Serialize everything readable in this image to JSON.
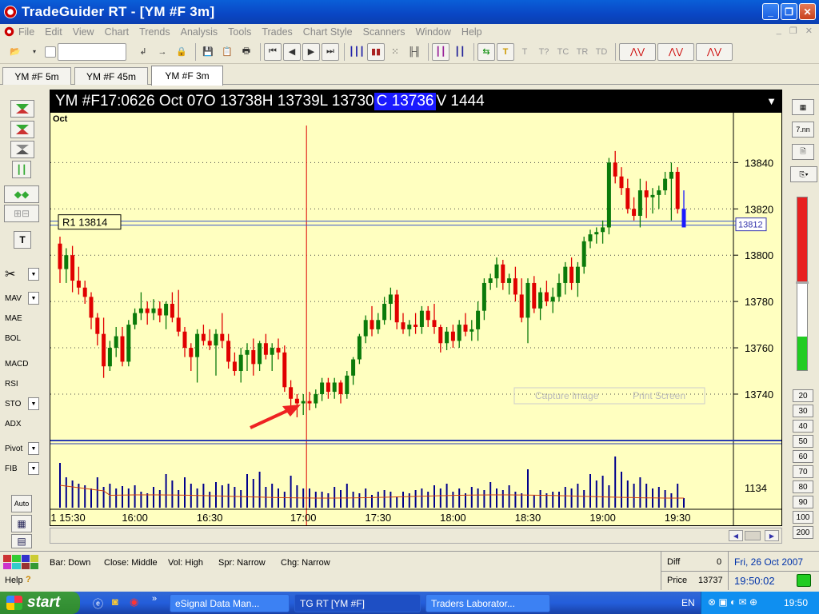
{
  "app": {
    "title": "TradeGuider RT   - [YM #F 3m]"
  },
  "menu": [
    "File",
    "Edit",
    "View",
    "Chart",
    "Trends",
    "Analysis",
    "Tools",
    "Trades",
    "Chart Style",
    "Scanners",
    "Window",
    "Help"
  ],
  "tabs": [
    {
      "label": "YM #F 5m"
    },
    {
      "label": "YM #F 45m"
    },
    {
      "label": "YM #F 3m"
    }
  ],
  "left_panel": {
    "labels": [
      "MAV",
      "MAE",
      "BOL",
      "MACD",
      "RSI",
      "STO",
      "ADX",
      "Pivot",
      "FIB"
    ],
    "auto": "Auto",
    "text_tool": "T"
  },
  "right_panel": {
    "zoom_label": "7.nn",
    "periods": [
      "20",
      "30",
      "40",
      "50",
      "60",
      "70",
      "80",
      "90",
      "100",
      "200"
    ]
  },
  "chart": {
    "info": {
      "symbol": "YM #F",
      "time": "17:06",
      "date": "26 Oct 07",
      "open": "O 13738",
      "high": "H 13739",
      "low": "L 13730",
      "close": "C 13736",
      "volume": "V 1444"
    },
    "month": "Oct",
    "pivot_label": "R1 13814",
    "price_tag": "13812",
    "volume_label": "1134",
    "overlay": {
      "capture": "Capture Image",
      "print": "Print Screen"
    },
    "colors": {
      "up": "#0a7a0a",
      "down": "#e00000",
      "background": "#ffffc0",
      "volume": "#00008b",
      "pivot": "#3a55c8"
    }
  },
  "chart_data": {
    "type": "candlestick",
    "x_ticks": [
      "15:30",
      "16:00",
      "16:30",
      "17:00",
      "17:30",
      "18:00",
      "18:30",
      "19:00",
      "19:30"
    ],
    "y_ticks": [
      13740,
      13760,
      13780,
      13800,
      13820,
      13840
    ],
    "ylim": [
      13721,
      13856
    ],
    "pivot_R1": 13814,
    "marked_bar_time": "17:00",
    "candles": [
      [
        13805,
        13808,
        13788,
        13794
      ],
      [
        13794,
        13803,
        13788,
        13800
      ],
      [
        13800,
        13804,
        13784,
        13789
      ],
      [
        13789,
        13795,
        13783,
        13786
      ],
      [
        13786,
        13789,
        13779,
        13782
      ],
      [
        13782,
        13784,
        13768,
        13773
      ],
      [
        13773,
        13775,
        13761,
        13766
      ],
      [
        13766,
        13773,
        13747,
        13752
      ],
      [
        13752,
        13763,
        13750,
        13760
      ],
      [
        13760,
        13769,
        13756,
        13765
      ],
      [
        13765,
        13769,
        13752,
        13754
      ],
      [
        13754,
        13772,
        13752,
        13770
      ],
      [
        13770,
        13777,
        13768,
        13775
      ],
      [
        13775,
        13784,
        13772,
        13777
      ],
      [
        13777,
        13780,
        13770,
        13775
      ],
      [
        13775,
        13781,
        13772,
        13777
      ],
      [
        13777,
        13780,
        13771,
        13774
      ],
      [
        13774,
        13780,
        13768,
        13779
      ],
      [
        13779,
        13784,
        13771,
        13773
      ],
      [
        13773,
        13785,
        13765,
        13767
      ],
      [
        13767,
        13769,
        13756,
        13760
      ],
      [
        13760,
        13762,
        13750,
        13756
      ],
      [
        13756,
        13768,
        13745,
        13766
      ],
      [
        13766,
        13770,
        13761,
        13763
      ],
      [
        13763,
        13768,
        13759,
        13761
      ],
      [
        13761,
        13768,
        13748,
        13766
      ],
      [
        13766,
        13775,
        13760,
        13763
      ],
      [
        13763,
        13766,
        13751,
        13754
      ],
      [
        13754,
        13758,
        13748,
        13750
      ],
      [
        13750,
        13760,
        13745,
        13757
      ],
      [
        13757,
        13762,
        13750,
        13759
      ],
      [
        13759,
        13764,
        13748,
        13753
      ],
      [
        13753,
        13763,
        13750,
        13762
      ],
      [
        13762,
        13766,
        13755,
        13757
      ],
      [
        13757,
        13762,
        13750,
        13760
      ],
      [
        13760,
        13764,
        13755,
        13758
      ],
      [
        13758,
        13761,
        13741,
        13743
      ],
      [
        13743,
        13746,
        13735,
        13738
      ],
      [
        13738,
        13740,
        13730,
        13736
      ],
      [
        13736,
        13740,
        13731,
        13737
      ],
      [
        13737,
        13741,
        13733,
        13736
      ],
      [
        13736,
        13742,
        13734,
        13740
      ],
      [
        13740,
        13747,
        13737,
        13745
      ],
      [
        13745,
        13747,
        13738,
        13741
      ],
      [
        13741,
        13747,
        13738,
        13745
      ],
      [
        13745,
        13746,
        13736,
        13740
      ],
      [
        13740,
        13750,
        13738,
        13748
      ],
      [
        13748,
        13756,
        13744,
        13755
      ],
      [
        13755,
        13766,
        13753,
        13765
      ],
      [
        13765,
        13774,
        13762,
        13772
      ],
      [
        13772,
        13778,
        13765,
        13768
      ],
      [
        13768,
        13775,
        13766,
        13772
      ],
      [
        13772,
        13782,
        13770,
        13779
      ],
      [
        13779,
        13786,
        13772,
        13783
      ],
      [
        13783,
        13785,
        13768,
        13771
      ],
      [
        13771,
        13775,
        13766,
        13768
      ],
      [
        13768,
        13772,
        13765,
        13770
      ],
      [
        13770,
        13775,
        13766,
        13769
      ],
      [
        13769,
        13778,
        13766,
        13776
      ],
      [
        13776,
        13778,
        13769,
        13772
      ],
      [
        13772,
        13779,
        13766,
        13769
      ],
      [
        13769,
        13770,
        13758,
        13762
      ],
      [
        13762,
        13769,
        13759,
        13767
      ],
      [
        13767,
        13770,
        13760,
        13763
      ],
      [
        13763,
        13772,
        13760,
        13770
      ],
      [
        13770,
        13775,
        13765,
        13767
      ],
      [
        13767,
        13772,
        13763,
        13768
      ],
      [
        13768,
        13780,
        13763,
        13776
      ],
      [
        13776,
        13790,
        13772,
        13788
      ],
      [
        13788,
        13792,
        13785,
        13790
      ],
      [
        13790,
        13799,
        13786,
        13796
      ],
      [
        13796,
        13798,
        13785,
        13788
      ],
      [
        13788,
        13792,
        13783,
        13790
      ],
      [
        13790,
        13795,
        13780,
        13783
      ],
      [
        13783,
        13790,
        13771,
        13773
      ],
      [
        13773,
        13790,
        13762,
        13788
      ],
      [
        13788,
        13791,
        13775,
        13777
      ],
      [
        13777,
        13786,
        13772,
        13784
      ],
      [
        13784,
        13789,
        13778,
        13780
      ],
      [
        13780,
        13786,
        13775,
        13782
      ],
      [
        13782,
        13792,
        13780,
        13788
      ],
      [
        13788,
        13797,
        13783,
        13795
      ],
      [
        13795,
        13799,
        13785,
        13788
      ],
      [
        13788,
        13797,
        13782,
        13795
      ],
      [
        13795,
        13808,
        13792,
        13806
      ],
      [
        13806,
        13811,
        13803,
        13809
      ],
      [
        13809,
        13812,
        13805,
        13810
      ],
      [
        13810,
        13815,
        13805,
        13812
      ],
      [
        13812,
        13842,
        13809,
        13840
      ],
      [
        13840,
        13845,
        13831,
        13834
      ],
      [
        13834,
        13838,
        13826,
        13829
      ],
      [
        13829,
        13833,
        13818,
        13820
      ],
      [
        13820,
        13825,
        13815,
        13817
      ],
      [
        13817,
        13833,
        13812,
        13828
      ],
      [
        13828,
        13832,
        13816,
        13825
      ],
      [
        13825,
        13829,
        13818,
        13826
      ],
      [
        13826,
        13830,
        13820,
        13828
      ],
      [
        13828,
        13836,
        13826,
        13833
      ],
      [
        13833,
        13840,
        13815,
        13836
      ],
      [
        13836,
        13838,
        13818,
        13820
      ],
      [
        13820,
        13828,
        13815,
        13812
      ]
    ],
    "volume": [
      56,
      38,
      34,
      30,
      28,
      24,
      38,
      26,
      30,
      24,
      27,
      24,
      28,
      20,
      18,
      26,
      22,
      42,
      34,
      22,
      38,
      30,
      24,
      30,
      20,
      32,
      28,
      30,
      26,
      22,
      42,
      36,
      45,
      26,
      30,
      24,
      20,
      40,
      28,
      24,
      24,
      20,
      20,
      18,
      26,
      22,
      30,
      20,
      18,
      24,
      16,
      20,
      22,
      20,
      14,
      20,
      18,
      22,
      24,
      20,
      28,
      24,
      30,
      20,
      24,
      18,
      26,
      24,
      22,
      32,
      24,
      22,
      28,
      20,
      18,
      48,
      16,
      22,
      18,
      20,
      20,
      26,
      24,
      30,
      22,
      42,
      34,
      40,
      28,
      64,
      45,
      34,
      30,
      38,
      30,
      24,
      26,
      22,
      18,
      30,
      12
    ],
    "volume_avg_range": [
      13,
      19
    ]
  },
  "status": {
    "bar": "Bar: Down",
    "close": "Close: Middle",
    "vol": "Vol: High",
    "spr": "Spr: Narrow",
    "chg": "Chg: Narrow",
    "diff_label": "Diff",
    "diff_value": "0",
    "price_label": "Price",
    "price_value": "13737",
    "date": "Fri, 26 Oct 2007",
    "time": "19:50:02",
    "help": "Help"
  },
  "taskbar": {
    "start": "start",
    "tasks": [
      "eSignal Data Man...",
      "TG RT   [YM #F]",
      "Traders Laborator..."
    ],
    "lang": "EN",
    "clock": "19:50"
  }
}
